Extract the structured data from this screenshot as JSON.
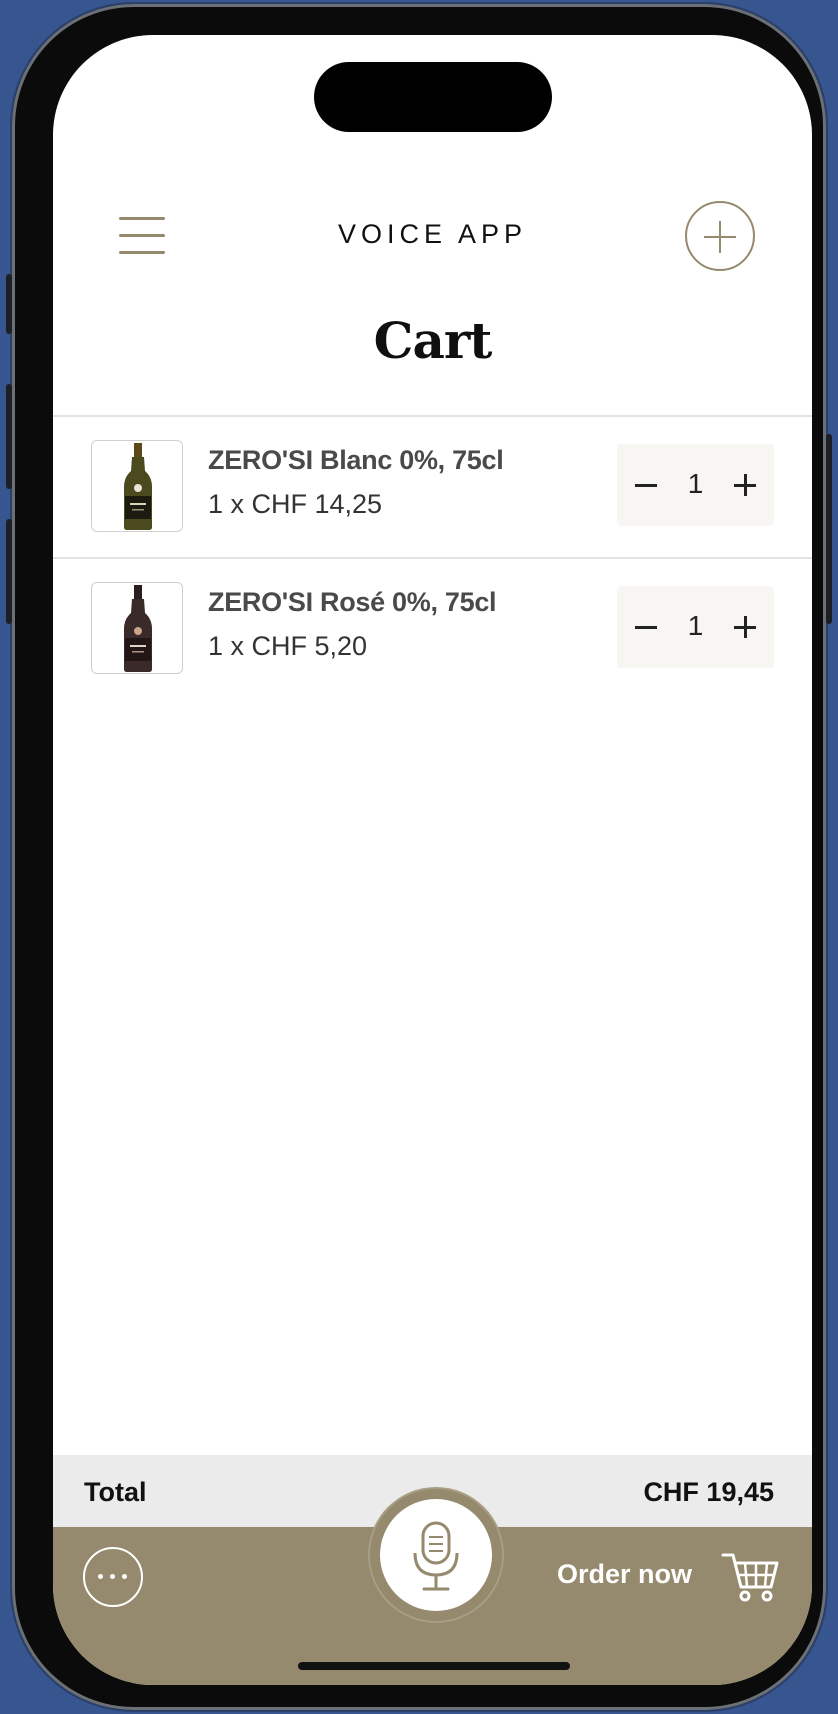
{
  "header": {
    "app_title": "VOICE APP",
    "menu_icon": "hamburger-menu-icon",
    "add_icon": "plus-circle-icon"
  },
  "page": {
    "title": "Cart"
  },
  "cart": {
    "items": [
      {
        "name": "ZERO'SI Blanc 0%, 75cl",
        "price_line": "1 x CHF 14,25",
        "quantity": "1",
        "bottle_color": "#4a4a1e"
      },
      {
        "name": "ZERO'SI Rosé 0%, 75cl",
        "price_line": "1 x CHF 5,20",
        "quantity": "1",
        "bottle_color": "#3a2a2a"
      }
    ]
  },
  "footer": {
    "total_label": "Total",
    "total_value": "CHF 19,45",
    "order_label": "Order now",
    "more_icon": "more-dots-icon",
    "mic_icon": "microphone-icon",
    "cart_icon": "shopping-cart-icon"
  },
  "colors": {
    "accent": "#958a6d",
    "background": "#37558f",
    "total_bar": "#ebebeb",
    "stepper_bg": "#f7f6f3"
  }
}
